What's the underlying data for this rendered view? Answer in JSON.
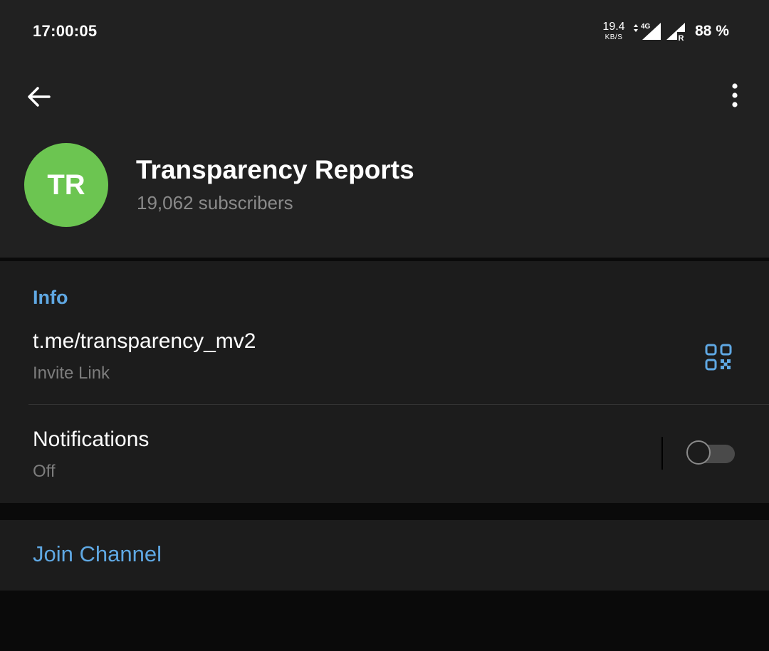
{
  "status_bar": {
    "time": "17:00:05",
    "net_speed_value": "19.4",
    "net_speed_unit": "KB/S",
    "network_type": "4G",
    "roaming_indicator": "R",
    "battery": "88 %"
  },
  "toolbar": {
    "back_icon": "arrow-back-icon",
    "menu_icon": "more-vertical-icon"
  },
  "profile": {
    "avatar_initials": "TR",
    "avatar_color": "#6cc551",
    "title": "Transparency Reports",
    "subtitle": "19,062 subscribers"
  },
  "info": {
    "section_title": "Info",
    "link_value": "t.me/transparency_mv2",
    "link_label": "Invite Link",
    "qr_icon": "qr-code-icon",
    "notifications_title": "Notifications",
    "notifications_status": "Off",
    "notifications_enabled": false
  },
  "actions": {
    "join_label": "Join Channel"
  },
  "colors": {
    "accent": "#5fa8e3",
    "header_bg": "#212121",
    "section_bg": "#1c1c1c",
    "app_bg": "#0a0a0a",
    "secondary_text": "#7d7d7d"
  }
}
